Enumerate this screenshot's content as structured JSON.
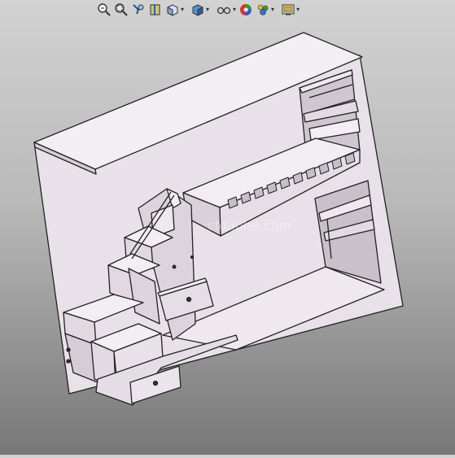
{
  "app": {
    "name": "3D CAD model viewport"
  },
  "toolbar": {
    "buttons": [
      {
        "name": "zoom-to-fit",
        "icon": "zoom-fit-icon"
      },
      {
        "name": "zoom-to-area",
        "icon": "zoom-area-icon"
      },
      {
        "name": "previous-view",
        "icon": "previous-view-icon"
      },
      {
        "name": "section-view",
        "icon": "section-view-icon"
      },
      {
        "name": "view-orientation",
        "icon": "view-orientation-icon",
        "dropdown": true
      },
      {
        "name": "display-style",
        "icon": "display-style-icon",
        "dropdown": true
      },
      {
        "name": "hide-show-items",
        "icon": "hide-show-icon",
        "dropdown": true
      },
      {
        "name": "edit-appearance",
        "icon": "appearance-icon"
      },
      {
        "name": "apply-scene",
        "icon": "scene-icon",
        "dropdown": true
      },
      {
        "name": "view-settings",
        "icon": "view-settings-icon",
        "dropdown": true
      }
    ]
  },
  "watermark": "cfdaohe.com",
  "model": {
    "name": "loft-bed-with-storage-stairs",
    "color": "#ece4ec",
    "shadow": "#c8bcc8"
  }
}
